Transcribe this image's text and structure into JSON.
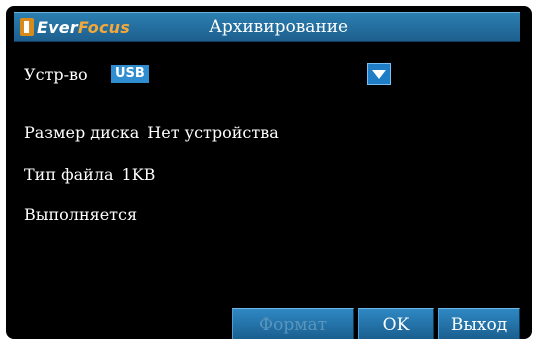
{
  "header": {
    "logo_text_a": "Ever",
    "logo_text_b": "Focus",
    "title": "Архивирование"
  },
  "device": {
    "label": "Устр-во",
    "selected": "USB",
    "dropdown_icon": "triangle-down"
  },
  "info": {
    "disk_size_label": "Размер диска",
    "disk_size_value": "Нет устройства",
    "file_type_label": "Тип файла",
    "file_type_value": "1KB",
    "status": "Выполняется"
  },
  "buttons": {
    "format": "Формат",
    "ok": "OK",
    "exit": "Выход"
  },
  "colors": {
    "titlebar": "#2b7fb1",
    "button": "#2e88c3",
    "accent_select": "#2f8dd0",
    "background": "#000000"
  }
}
